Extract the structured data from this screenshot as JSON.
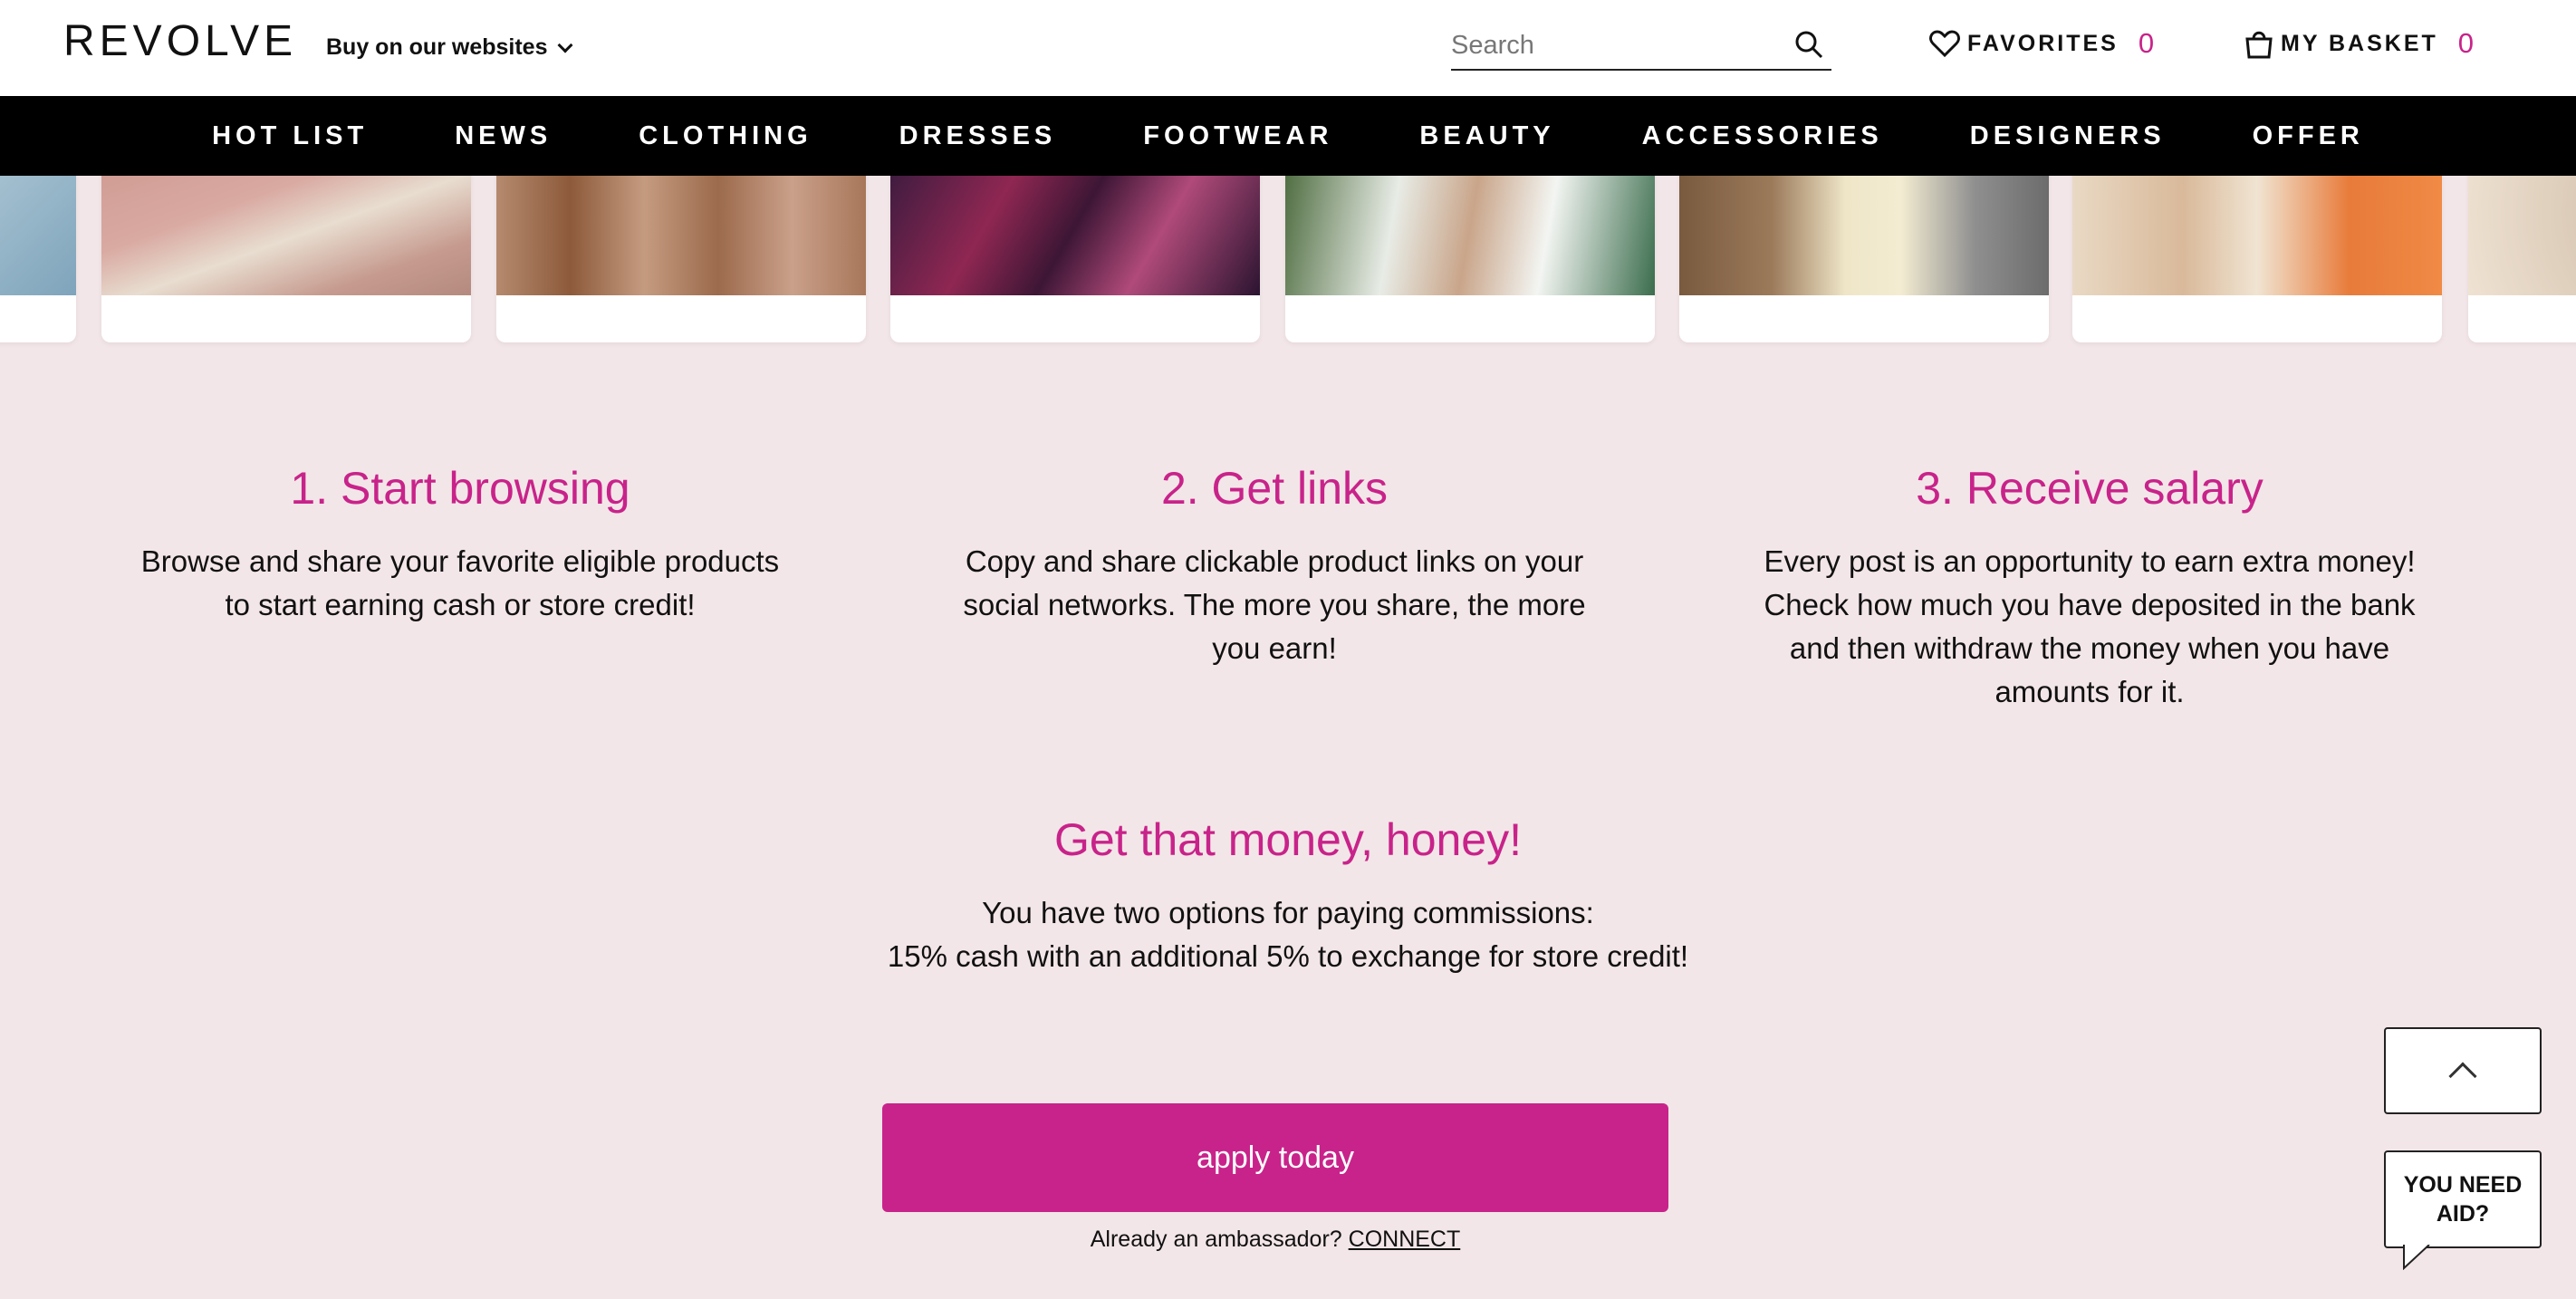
{
  "header": {
    "logo": "REVOLVE",
    "buy_sites_label": "Buy on our websites",
    "search_placeholder": "Search",
    "favorites_label": "FAVORITES",
    "favorites_count": "0",
    "basket_label": "MY BASKET",
    "basket_count": "0"
  },
  "nav": {
    "items": [
      "HOT LIST",
      "NEWS",
      "CLOTHING",
      "DRESSES",
      "FOOTWEAR",
      "BEAUTY",
      "ACCESSORIES",
      "DESIGNERS",
      "OFFER"
    ]
  },
  "steps": [
    {
      "title": "1. Start browsing",
      "text": "Browse and share your favorite eligible products to start earning cash or store credit!"
    },
    {
      "title": "2. Get links",
      "text": "Copy and share clickable product links on your social networks. The more you share, the more you earn!"
    },
    {
      "title": "3. Receive salary",
      "text": "Every post is an opportunity to earn extra money! Check how much you have deposited in the bank and then withdraw the money when you have amounts for it."
    }
  ],
  "money": {
    "title": "Get that money, honey!",
    "line1": "You have two options for paying commissions:",
    "line2": "15% cash with an additional 5% to exchange for store credit!"
  },
  "cta": {
    "apply_label": "apply today",
    "ambassador_text": "Already an ambassador?",
    "connect_label": "CONNECT"
  },
  "widgets": {
    "aid_label_line1": "YOU NEED",
    "aid_label_line2": "AID?"
  },
  "colors": {
    "accent": "#c8238a",
    "page_bg": "#f3e6e8",
    "nav_bg": "#000000"
  }
}
